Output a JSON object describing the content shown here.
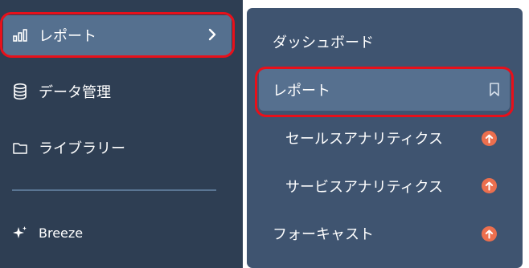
{
  "sidebar": {
    "items": [
      {
        "label": "レポート",
        "icon": "bar-chart-icon"
      },
      {
        "label": "データ管理",
        "icon": "database-icon"
      },
      {
        "label": "ライブラリー",
        "icon": "folder-icon"
      },
      {
        "label": "Breeze",
        "icon": "sparkle-icon"
      }
    ]
  },
  "flyout": {
    "items": [
      {
        "label": "ダッシュボード"
      },
      {
        "label": "レポート",
        "icon": "bookmark-icon"
      },
      {
        "label": "セールスアナリティクス",
        "icon": "upgrade-arrow-icon"
      },
      {
        "label": "サービスアナリティクス",
        "icon": "upgrade-arrow-icon"
      },
      {
        "label": "フォーキャスト",
        "icon": "upgrade-arrow-icon"
      }
    ]
  },
  "colors": {
    "sidebar_bg": "#2e3e53",
    "flyout_bg": "#3f5470",
    "active_bg": "#55708f",
    "highlight_ring": "#e8101a",
    "upgrade_badge": "#ec6f4e"
  }
}
